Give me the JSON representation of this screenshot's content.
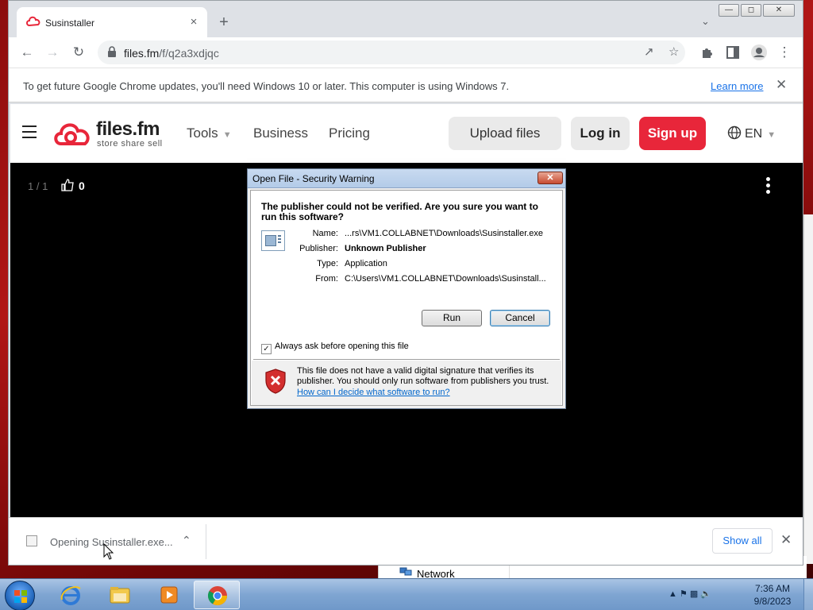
{
  "browser": {
    "tab_title": "Susinstaller",
    "tab_close": "×",
    "new_tab": "+",
    "url_host": "files.fm",
    "url_path": "/f/q2a3xdjqc"
  },
  "infobar": {
    "message": "To get future Google Chrome updates, you'll need Windows 10 or later. This computer is using Windows 7.",
    "link": "Learn more",
    "close": "✕"
  },
  "site": {
    "logo_name": "files.fm",
    "logo_tagline": "store share sell",
    "nav": [
      "Tools",
      "Business",
      "Pricing"
    ],
    "upload": "Upload files",
    "login": "Log in",
    "signup": "Sign up",
    "lang": "EN",
    "colors": {
      "brand": "#e8263a"
    }
  },
  "viewer": {
    "counter": "1 / 1",
    "likes": "0"
  },
  "dialog": {
    "title": "Open File - Security Warning",
    "question": "The publisher could not be verified.  Are you sure you want to run this software?",
    "fields": [
      {
        "key": "Name:",
        "value": "...rs\\VM1.COLLABNET\\Downloads\\Susinstaller.exe"
      },
      {
        "key": "Publisher:",
        "value": "Unknown Publisher"
      },
      {
        "key": "Type:",
        "value": "Application"
      },
      {
        "key": "From:",
        "value": "C:\\Users\\VM1.COLLABNET\\Downloads\\Susinstall..."
      }
    ],
    "run": "Run",
    "cancel": "Cancel",
    "always_ask": "Always ask before opening this file",
    "always_ask_checked": true,
    "warning": "This file does not have a valid digital signature that verifies its publisher.  You should only run software from publishers you trust.",
    "help_link": "How can I decide what software to run?"
  },
  "download_bar": {
    "label": "Opening Susinstaller.exe...",
    "show_all": "Show all",
    "close": "✕"
  },
  "background_window": {
    "label": "Network"
  },
  "taskbar": {
    "time": "7:36 AM",
    "date": "9/8/2023"
  }
}
